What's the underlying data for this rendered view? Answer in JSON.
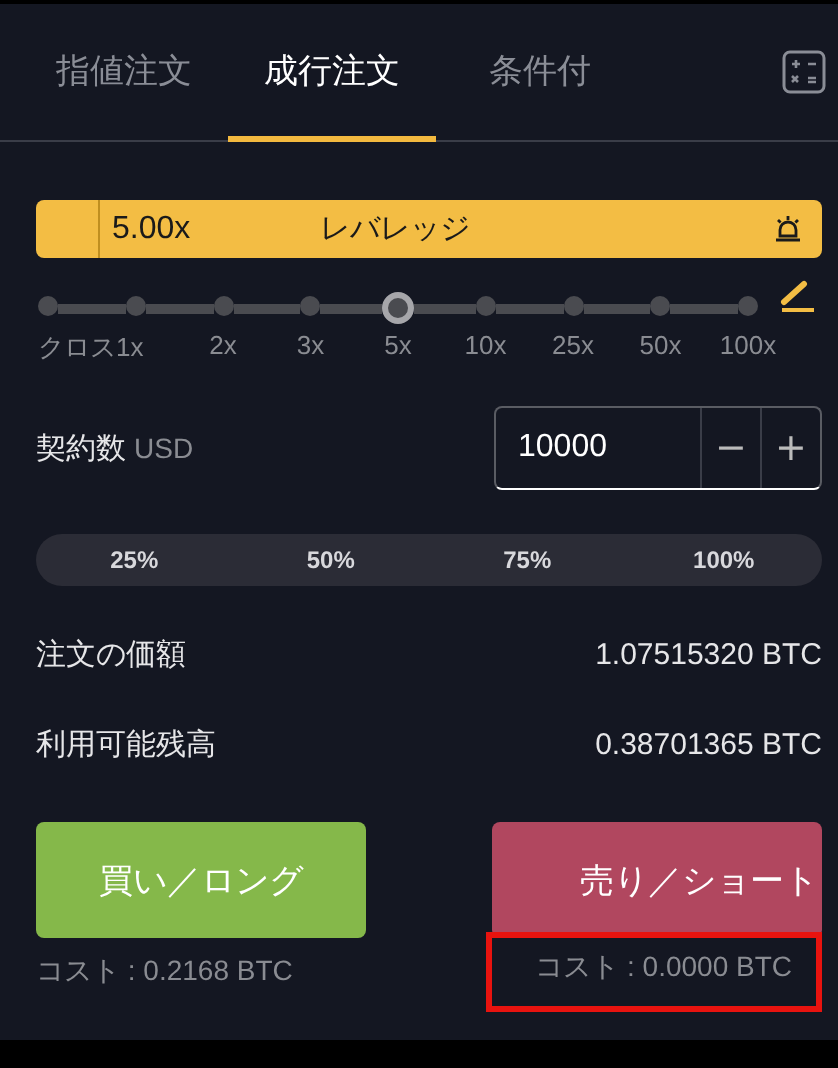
{
  "tabs": [
    {
      "label": "指値注文",
      "selected": false
    },
    {
      "label": "成行注文",
      "selected": true
    },
    {
      "label": "条件付",
      "selected": false
    }
  ],
  "leverage": {
    "value": "5.00x",
    "label": "レバレッジ"
  },
  "leverage_slider": {
    "stops": [
      {
        "label": "クロス1x",
        "selected": false
      },
      {
        "selected": false
      },
      {
        "label": "2x",
        "selected": false
      },
      {
        "label": "3x",
        "selected": false
      },
      {
        "label": "5x",
        "selected": true
      },
      {
        "label": "10x",
        "selected": false
      },
      {
        "label": "25x",
        "selected": false
      },
      {
        "label": "50x",
        "selected": false
      },
      {
        "label": "100x",
        "selected": false
      }
    ]
  },
  "quantity": {
    "label": "契約数",
    "unit": "USD",
    "value": "10000",
    "minus": "−",
    "plus": "+"
  },
  "percent_buttons": [
    "25%",
    "50%",
    "75%",
    "100%"
  ],
  "summary": [
    {
      "label": "注文の価額",
      "value": "1.07515320 BTC"
    },
    {
      "label": "利用可能残高",
      "value": "0.38701365 BTC"
    }
  ],
  "actions": [
    {
      "kind": "buy",
      "label": "買い／ロング",
      "cost": "コスト : 0.2168 BTC",
      "highlighted": false
    },
    {
      "kind": "sell",
      "label": "売り／ショート",
      "cost": "コスト : 0.0000 BTC",
      "highlighted": true
    }
  ]
}
